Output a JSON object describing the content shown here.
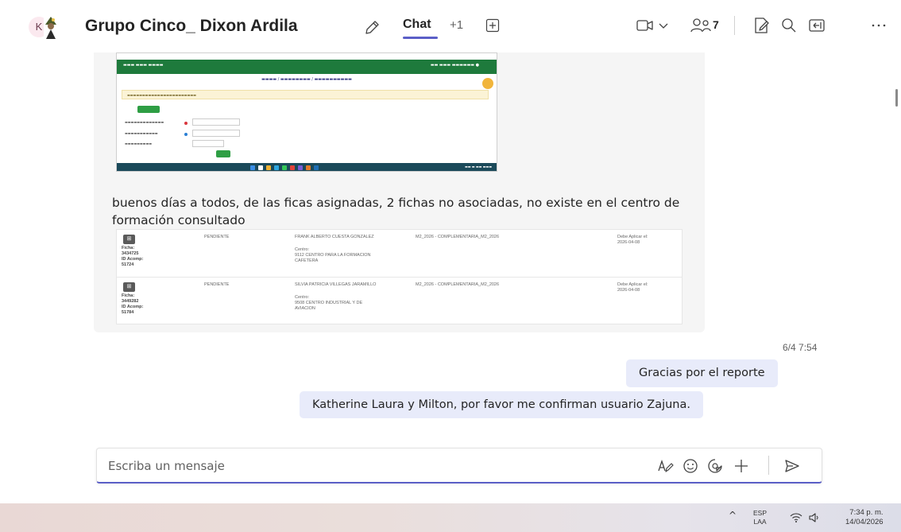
{
  "header": {
    "avatar_initial": "K",
    "title": "Grupo Cinco_ Dixon Ardila",
    "tab_chat": "Chat",
    "tab_more": "+1",
    "people_count": "7",
    "icons": [
      "edit-icon",
      "add-tab-icon",
      "video-call-icon",
      "chevron-down-icon",
      "people-icon",
      "notes-icon",
      "search-icon",
      "popout-icon",
      "more-icon"
    ]
  },
  "messages": {
    "text": "buenos días a todos, de las ficas asignadas, 2 fichas no asociadas,  no existe en el centro de formación consultado",
    "table_rows": [
      {
        "icon": "⊞",
        "ficha": "Ficha:\n3434725\nID Acomp:\n51724",
        "estado": "PENDIENTE",
        "nombre": "FRANK ALBERTO CUESTA GONZALEZ",
        "centro": "Centro:\n9112 CENTRO PARA LA FORMACION\nCAFETERA",
        "programa": "M2_2026 - COMPLEMENTARIA_M2_2026",
        "fecha": "Debe Aplicar el:\n2026-04-08"
      },
      {
        "icon": "⊞",
        "ficha": "Ficha:\n3449282\nID Acomp:\n51784",
        "estado": "PENDIENTE",
        "nombre": "SILVIA PATRICIA VILLEGAS JARAMILLO",
        "centro": "Centro:\n9508 CENTRO INDUSTRIAL Y DE\nAVIACION",
        "programa": "M2_2026 - COMPLEMENTARIA_M2_2026",
        "fecha": "Debe Aplicar el:\n2026-04-08"
      }
    ],
    "timestamp": "6/4 7:54",
    "reply1": "Gracias por el reporte",
    "reply2": "Katherine Laura y Milton, por favor me confirman usuario Zajuna."
  },
  "composer": {
    "placeholder": "Escriba un mensaje",
    "icons": [
      "format-icon",
      "emoji-icon",
      "sticker-icon",
      "attach-icon",
      "send-icon"
    ]
  },
  "taskbar": {
    "lang_line1": "ESP",
    "lang_line2": "LAA",
    "time": "7:34 p. m.",
    "date": "14/04/2026"
  },
  "colors": {
    "accent": "#5b5fc7",
    "bubble": "#e8ebfa",
    "card": "#f5f5f5"
  }
}
